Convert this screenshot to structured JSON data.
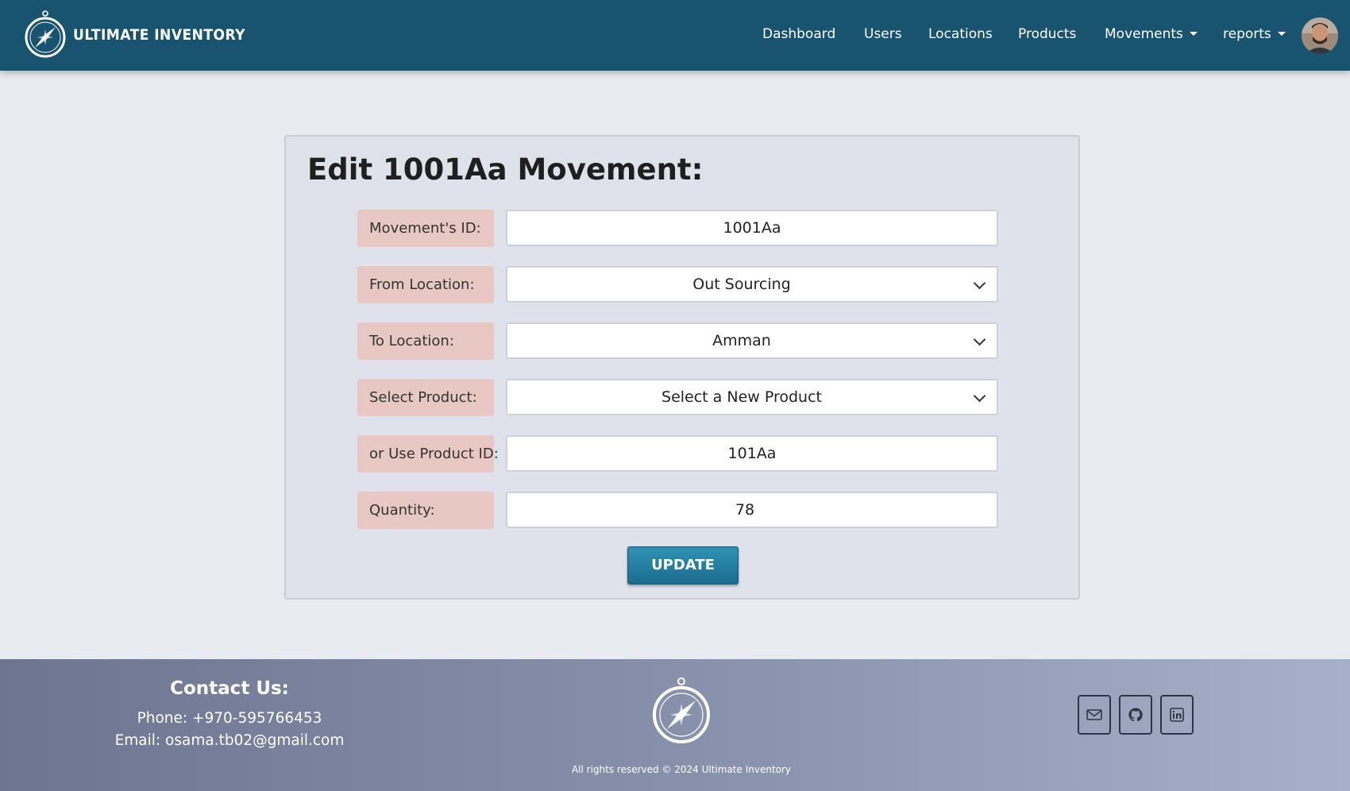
{
  "brand": {
    "name": "ULTIMATE INVENTORY"
  },
  "nav": {
    "items": [
      {
        "label": "Dashboard"
      },
      {
        "label": "Users"
      },
      {
        "label": "Locations"
      },
      {
        "label": "Products"
      },
      {
        "label": "Movements",
        "dropdown": true
      },
      {
        "label": "reports",
        "dropdown": true
      }
    ]
  },
  "form": {
    "title": "Edit 1001Aa Movement:",
    "rows": [
      {
        "label": "Movement's ID:",
        "value": "1001Aa",
        "type": "text"
      },
      {
        "label": "From Location:",
        "value": "Out Sourcing",
        "type": "select"
      },
      {
        "label": "To Location:",
        "value": "Amman",
        "type": "select"
      },
      {
        "label": "Select Product:",
        "value": "Select a New Product",
        "type": "select"
      },
      {
        "label": "or Use Product ID:",
        "value": "101Aa",
        "type": "text"
      },
      {
        "label": "Quantity:",
        "value": "78",
        "type": "number"
      }
    ],
    "submit_label": "UPDATE"
  },
  "footer": {
    "contact_title": "Contact Us:",
    "phone": "Phone: +970-595766453",
    "email": "Email: osama.tb02@gmail.com",
    "copyright": "All rights reserved © 2024 Ultimate Inventory",
    "social_icons": [
      "mail-icon",
      "github-icon",
      "linkedin-icon"
    ]
  },
  "colors": {
    "navbar": "#18536f",
    "label_bg": "#e8c8c2",
    "button": "#2380a3",
    "page_bg": "#e8ebef"
  }
}
